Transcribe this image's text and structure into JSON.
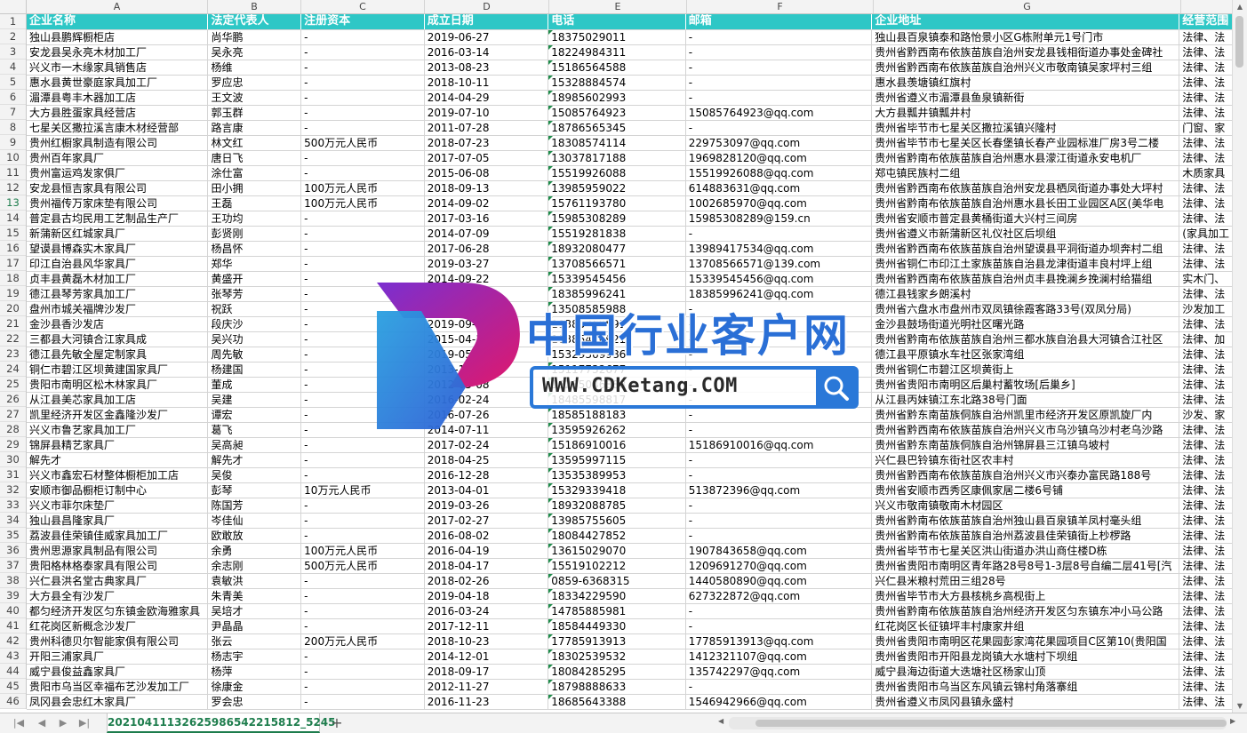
{
  "columns": [
    "A",
    "B",
    "C",
    "D",
    "E",
    "F",
    "G",
    ""
  ],
  "active_row": "13",
  "headers": [
    "企业名称",
    "法定代表人",
    "注册资本",
    "成立日期",
    "电话",
    "邮箱",
    "企业地址",
    "经营范围"
  ],
  "rows": [
    [
      "2",
      "独山县鹏辉橱柜店",
      "尚华鹏",
      "-",
      "2019-06-27",
      "18375029011",
      "-",
      "独山县百泉镇泰和路怡景小区G栋附单元1号门市",
      "法律、法"
    ],
    [
      "3",
      "安龙县吴永亮木材加工厂",
      "吴永亮",
      "-",
      "2016-03-14",
      "18224984311",
      "-",
      "贵州省黔西南布依族苗族自治州安龙县钱相街道办事处金碑社",
      "法律、法"
    ],
    [
      "4",
      "兴义市一木缘家具销售店",
      "杨维",
      "-",
      "2013-08-23",
      "15186564588",
      "-",
      "贵州省黔西南布依族苗族自治州兴义市敬南镇吴家坪村三组",
      "法律、法"
    ],
    [
      "5",
      "惠水县黄世豪庭家具加工厂",
      "罗应忠",
      "-",
      "2018-10-11",
      "15328884574",
      "-",
      "惠水县羡塘镇红旗村",
      "法律、法"
    ],
    [
      "6",
      "湄潭县粤丰木器加工店",
      "王文波",
      "-",
      "2014-04-29",
      "18985602993",
      "-",
      "贵州省遵义市湄潭县鱼泉镇新街",
      "法律、法"
    ],
    [
      "7",
      "大方县胜蛋家具经营店",
      "郭玉群",
      "-",
      "2019-07-10",
      "15085764923",
      "15085764923@qq.com",
      "大方县瓢井镇瓢井村",
      "法律、法"
    ],
    [
      "8",
      "七星关区撒拉溪言康木材经营部",
      "路言康",
      "-",
      "2011-07-28",
      "18786565345",
      "-",
      "贵州省毕节市七星关区撒拉溪镇兴隆村",
      "门窗、家"
    ],
    [
      "9",
      "贵州红橱家具制造有限公司",
      "林文红",
      "500万元人民币",
      "2018-07-23",
      "18308574114",
      "229753097@qq.com",
      "贵州省毕节市七星关区长春堡镇长春产业园标准厂房3号二楼",
      "法律、法"
    ],
    [
      "10",
      "贵州百年家具厂",
      "唐日飞",
      "-",
      "2017-07-05",
      "13037817188",
      "1969828120@qq.com",
      "贵州省黔南布依族苗族自治州惠水县濛江街道永安电机厂",
      "法律、法"
    ],
    [
      "11",
      "贵州富运鸡发家俱厂",
      "涂仕富",
      "-",
      "2015-06-08",
      "15519926088",
      "15519926088@qq.com",
      "郑屯镇民族村二组",
      "木质家具"
    ],
    [
      "12",
      "安龙县恒吉家具有限公司",
      "田小拥",
      "100万元人民币",
      "2018-09-13",
      "13985959022",
      "614883631@qq.com",
      "贵州省黔西南布依族苗族自治州安龙县栖凤街道办事处大坪村",
      "法律、法"
    ],
    [
      "13",
      "贵州福传万家床垫有限公司",
      "王磊",
      "100万元人民币",
      "2014-09-02",
      "15761193780",
      "1002685970@qq.com",
      "贵州省黔南布依族苗族自治州惠水县长田工业园区A区(美华电",
      "法律、法"
    ],
    [
      "14",
      "普定县古均民用工艺制品生产厂",
      "王功均",
      "-",
      "2017-03-16",
      "15985308289",
      "15985308289@159.cn",
      "贵州省安顺市普定县黄桶街道大兴村三间房",
      "法律、法"
    ],
    [
      "15",
      "新蒲新区红城家具厂",
      "彭贤刚",
      "-",
      "2014-07-09",
      "15519281838",
      "-",
      "贵州省遵义市新蒲新区礼仪社区后坝组",
      "(家具加工"
    ],
    [
      "16",
      "望谟县博森实木家具厂",
      "杨昌怀",
      "-",
      "2017-06-28",
      "18932080477",
      "13989417534@qq.com",
      "贵州省黔西南布依族苗族自治州望谟县平洞街道办坝奔村二组",
      "法律、法"
    ],
    [
      "17",
      "印江自治县风华家具厂",
      "郑华",
      "-",
      "2019-03-27",
      "13708566571",
      "13708566571@139.com",
      "贵州省铜仁市印江土家族苗族自治县龙津街道丰良村坪上组",
      "法律、法"
    ],
    [
      "18",
      "贞丰县黄磊木材加工厂",
      "黄盛开",
      "-",
      "2014-09-22",
      "15339545456",
      "15339545456@qq.com",
      "贵州省黔西南布依族苗族自治州贞丰县挽澜乡挽澜村给猫组",
      "实木门、"
    ],
    [
      "19",
      "德江县琴芳家具加工厂",
      "张琴芳",
      "-",
      "2019-01-08",
      "18385996241",
      "18385996241@qq.com",
      "德江县钱家乡朗溪村",
      "法律、法"
    ],
    [
      "20",
      "盘州市城关福牌沙发厂",
      "祝跃",
      "-",
      "2015-09-10",
      "13508585988",
      "-",
      "贵州省六盘水市盘州市双凤镇徐霞客路33号(双凤分局)",
      "沙发加工"
    ],
    [
      "21",
      "金沙县香沙发店",
      "段庆沙",
      "-",
      "2019-09-18",
      "18385762891",
      "-",
      "金沙县鼓场街道光明社区曙光路",
      "法律、法"
    ],
    [
      "22",
      "三都县大河镇合江家具成",
      "吴兴功",
      "-",
      "2015-04-17",
      "18385476921",
      "-",
      "贵州省黔南布依族苗族自治州三都水族自治县大河镇合江社区",
      "法律、加"
    ],
    [
      "23",
      "德江县先敏全屋定制家具",
      "周先敏",
      "-",
      "2019-05-13",
      "15329369986",
      "-",
      "德江县平原镇水车社区张家湾组",
      "法律、法"
    ],
    [
      "24",
      "铜仁市碧江区坝黄建国家具厂",
      "杨建国",
      "-",
      "2013-10-15",
      "15117732677",
      "-",
      "贵州省铜仁市碧江区坝黄街上",
      "法律、法"
    ],
    [
      "25",
      "贵阳市南明区松木林家具厂",
      "董成",
      "-",
      "2012-05-08",
      "18285046888",
      "-",
      "贵州省贵阳市南明区后巢村蓄牧场[后巢乡]",
      "法律、法"
    ],
    [
      "26",
      "从江县美芯家具加工店",
      "吴建",
      "-",
      "2016-02-24",
      "18485598817",
      "-",
      "从江县丙妹镇江东北路38号门面",
      "法律、法"
    ],
    [
      "27",
      "凯里经济开发区金鑫隆沙发厂",
      "谭宏",
      "-",
      "2016-07-26",
      "18585188183",
      "-",
      "贵州省黔东南苗族侗族自治州凯里市经济开发区原凯旋厂内",
      "沙发、家"
    ],
    [
      "28",
      "兴义市鲁艺家具加工厂",
      "葛飞",
      "-",
      "2014-07-11",
      "13595926262",
      "-",
      "贵州省黔西南布依族苗族自治州兴义市乌沙镇乌沙村老乌沙路",
      "法律、法"
    ],
    [
      "29",
      "锦屏县精艺家具厂",
      "吴高昶",
      "-",
      "2017-02-24",
      "15186910016",
      "15186910016@qq.com",
      "贵州省黔东南苗族侗族自治州锦屏县三江镇乌坡村",
      "法律、法"
    ],
    [
      "30",
      "解先才",
      "解先才",
      "-",
      "2018-04-25",
      "13595997115",
      "-",
      "兴仁县巴铃镇东街社区农丰村",
      "法律、法"
    ],
    [
      "31",
      "兴义市鑫宏石材整体橱柜加工店",
      "吴俊",
      "-",
      "2016-12-28",
      "13535389953",
      "-",
      "贵州省黔西南布依族苗族自治州兴义市兴泰办富民路188号",
      "法律、法"
    ],
    [
      "32",
      "安顺市御品橱柜订制中心",
      "彭琴",
      "10万元人民币",
      "2013-04-01",
      "15329339418",
      "513872396@qq.com",
      "贵州省安顺市西秀区康佩家居二楼6号铺",
      "法律、法"
    ],
    [
      "33",
      "兴义市菲尔床垫厂",
      "陈国芳",
      "-",
      "2019-03-26",
      "18932088785",
      "-",
      "兴义市敬南镇敬南木材园区",
      "法律、法"
    ],
    [
      "34",
      "独山县昌隆家具厂",
      "岑佳仙",
      "-",
      "2017-02-27",
      "13985755605",
      "-",
      "贵州省黔南布依族苗族自治州独山县百泉镇羊凤村毫头组",
      "法律、法"
    ],
    [
      "35",
      "荔波县佳荣镇佳威家具加工厂",
      "欧敢放",
      "-",
      "2016-08-02",
      "18084427852",
      "-",
      "贵州省黔南布依族苗族自治州荔波县佳荣镇街上杪椤路",
      "法律、法"
    ],
    [
      "36",
      "贵州思源家具制品有限公司",
      "余勇",
      "100万元人民币",
      "2016-04-19",
      "13615029070",
      "1907843658@qq.com",
      "贵州省毕节市七星关区洪山街道办洪山商住楼D栋",
      "法律、法"
    ],
    [
      "37",
      "贵阳格林格泰家具有限公司",
      "余志刚",
      "500万元人民币",
      "2018-04-17",
      "15519102212",
      "1209691270@qq.com",
      "贵州省贵阳市南明区青年路28号8号1-3层8号自编二层41号[汽",
      "法律、法"
    ],
    [
      "38",
      "兴仁县洪名堂古典家具厂",
      "袁敏洪",
      "-",
      "2018-02-26",
      "0859-6368315",
      "1440580890@qq.com",
      "兴仁县米粮村荒田三组28号",
      "法律、法"
    ],
    [
      "39",
      "大方县全有沙发厂",
      "朱青美",
      "-",
      "2019-04-18",
      "18334229590",
      "627322872@qq.com",
      "贵州省毕节市大方县核桃乡高枧街上",
      "法律、法"
    ],
    [
      "40",
      "都匀经济开发区匀东镇金欧海雅家具",
      "吴培才",
      "-",
      "2016-03-24",
      "14785885981",
      "-",
      "贵州省黔南布依族苗族自治州经济开发区匀东镇东冲小马公路",
      "法律、法"
    ],
    [
      "41",
      "红花岗区新概念沙发厂",
      "尹晶晶",
      "-",
      "2017-12-11",
      "18584449330",
      "-",
      "红花岗区长征镇坪丰村康家井组",
      "法律、法"
    ],
    [
      "42",
      "贵州科德贝尔智能家俱有限公司",
      "张云",
      "200万元人民币",
      "2018-10-23",
      "17785913913",
      "17785913913@qq.com",
      "贵州省贵阳市南明区花果园彭家湾花果园项目C区第10(贵阳国",
      "法律、法"
    ],
    [
      "43",
      "开阳三浦家具厂",
      "杨志宇",
      "-",
      "2014-12-01",
      "18302539532",
      "1412321107@qq.com",
      "贵州省贵阳市开阳县龙岗镇大水塘村下坝组",
      "法律、法"
    ],
    [
      "44",
      "威宁县俊益鑫家具厂",
      "杨萍",
      "-",
      "2018-09-17",
      "18084285295",
      "135742297@qq.com",
      "威宁县海边街道大迭塘社区杨家山顶",
      "法律、法"
    ],
    [
      "45",
      "贵阳市乌当区幸福布艺沙发加工厂",
      "徐康金",
      "-",
      "2012-11-27",
      "18798888633",
      "-",
      "贵州省贵阳市乌当区东风镇云锦村角落寨组",
      "法律、法"
    ],
    [
      "46",
      "凤冈县会忠红木家具厂",
      "罗会忠",
      "-",
      "2016-11-23",
      "18685643388",
      "1546942966@qq.com",
      "贵州省遵义市凤冈县镇永盛村",
      "法律、法"
    ]
  ],
  "sheet_tab": "20210411132625986542215812_5245",
  "watermark": {
    "title": "中国行业客户网",
    "url": "WWW.CDKetang.COM"
  }
}
